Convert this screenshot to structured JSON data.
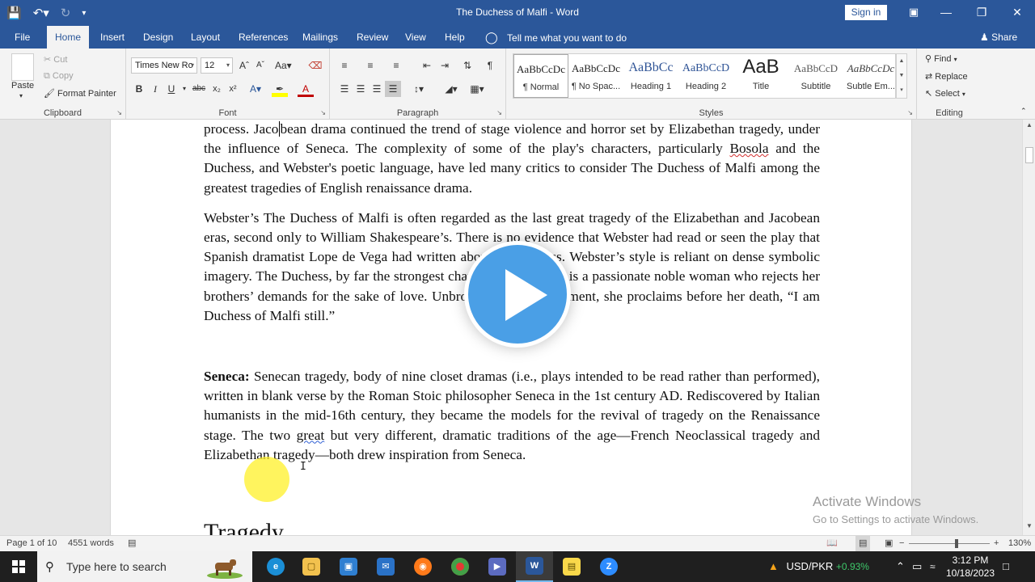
{
  "window": {
    "title": "The Duchess of Malfi  -  Word",
    "signin_label": "Sign in"
  },
  "tabs": [
    {
      "label": "File"
    },
    {
      "label": "Home"
    },
    {
      "label": "Insert"
    },
    {
      "label": "Design"
    },
    {
      "label": "Layout"
    },
    {
      "label": "References"
    },
    {
      "label": "Mailings"
    },
    {
      "label": "Review"
    },
    {
      "label": "View"
    },
    {
      "label": "Help"
    }
  ],
  "tell_me": "Tell me what you want to do",
  "share_label": "Share",
  "ribbon": {
    "clipboard": {
      "label": "Clipboard",
      "paste": "Paste",
      "cut": "Cut",
      "copy": "Copy",
      "format_painter": "Format Painter"
    },
    "font": {
      "label": "Font",
      "font_name": "Times New Ro",
      "font_size": "12"
    },
    "paragraph": {
      "label": "Paragraph"
    },
    "styles": {
      "label": "Styles",
      "items": [
        {
          "preview": "AaBbCcDc",
          "name": "¶ Normal"
        },
        {
          "preview": "AaBbCcDc",
          "name": "¶ No Spac..."
        },
        {
          "preview": "AaBbCc",
          "name": "Heading 1"
        },
        {
          "preview": "AaBbCcD",
          "name": "Heading 2"
        },
        {
          "preview": "AaB",
          "name": "Title"
        },
        {
          "preview": "AaBbCcD",
          "name": "Subtitle"
        },
        {
          "preview": "AaBbCcDc",
          "name": "Subtle Em..."
        }
      ]
    },
    "editing": {
      "label": "Editing",
      "find": "Find",
      "replace": "Replace",
      "select": "Select"
    }
  },
  "document": {
    "para1_a": "process. Jaco",
    "para1_b": "bean drama continued the trend of stage violence and horror set by Elizabethan tragedy, under the influence of Seneca. The complexity of some of the play's characters, particularly ",
    "para1_flag": "Bosola",
    "para1_c": " and the Duchess, and Webster's poetic language, have led many critics to consider The Duchess of Malfi among the greatest tragedies of English renaissance drama.",
    "para2": "Webster’s The Duchess of Malfi is often regarded as the last great tragedy of the Elizabethan and Jacobean eras, second only to William Shakespeare’s. There is no evidence that Webster had read or seen the play that Spanish dramatist Lope de Vega had written about the duchess. Webster’s style is reliant on dense symbolic imagery. The Duchess, by far the strongest character in the play, is a passionate noble woman who rejects her brothers’ demands for the sake of love. Unbroken by cruel treatment, she proclaims before her death, “I am Duchess of Malfi still.”",
    "para3_bold": "Seneca:",
    "para3_a": " Senecan tragedy, body of nine closet dramas (i.e., plays intended to be read rather than performed), written in blank verse by the Roman Stoic philosopher Seneca in the 1st century AD. Rediscovered by Italian humanists in the mid-16th century, they became the models for the revival of tragedy on the Renaissance stage. The two ",
    "para3_flag": "great",
    "para3_b": " but very different, dramatic traditions of the age—French Neoclassical tragedy and Elizabethan tragedy—both drew inspiration from Seneca.",
    "heading": "Tragedy"
  },
  "watermark": {
    "line1": "Activate Windows",
    "line2": "Go to Settings to activate Windows."
  },
  "status": {
    "page": "Page 1 of 10",
    "words": "4551 words",
    "zoom": "130%"
  },
  "taskbar": {
    "search_placeholder": "Type here to search",
    "currency": "USD/PKR",
    "currency_change": "+0.93%",
    "time": "3:12 PM",
    "date": "10/18/2023"
  }
}
